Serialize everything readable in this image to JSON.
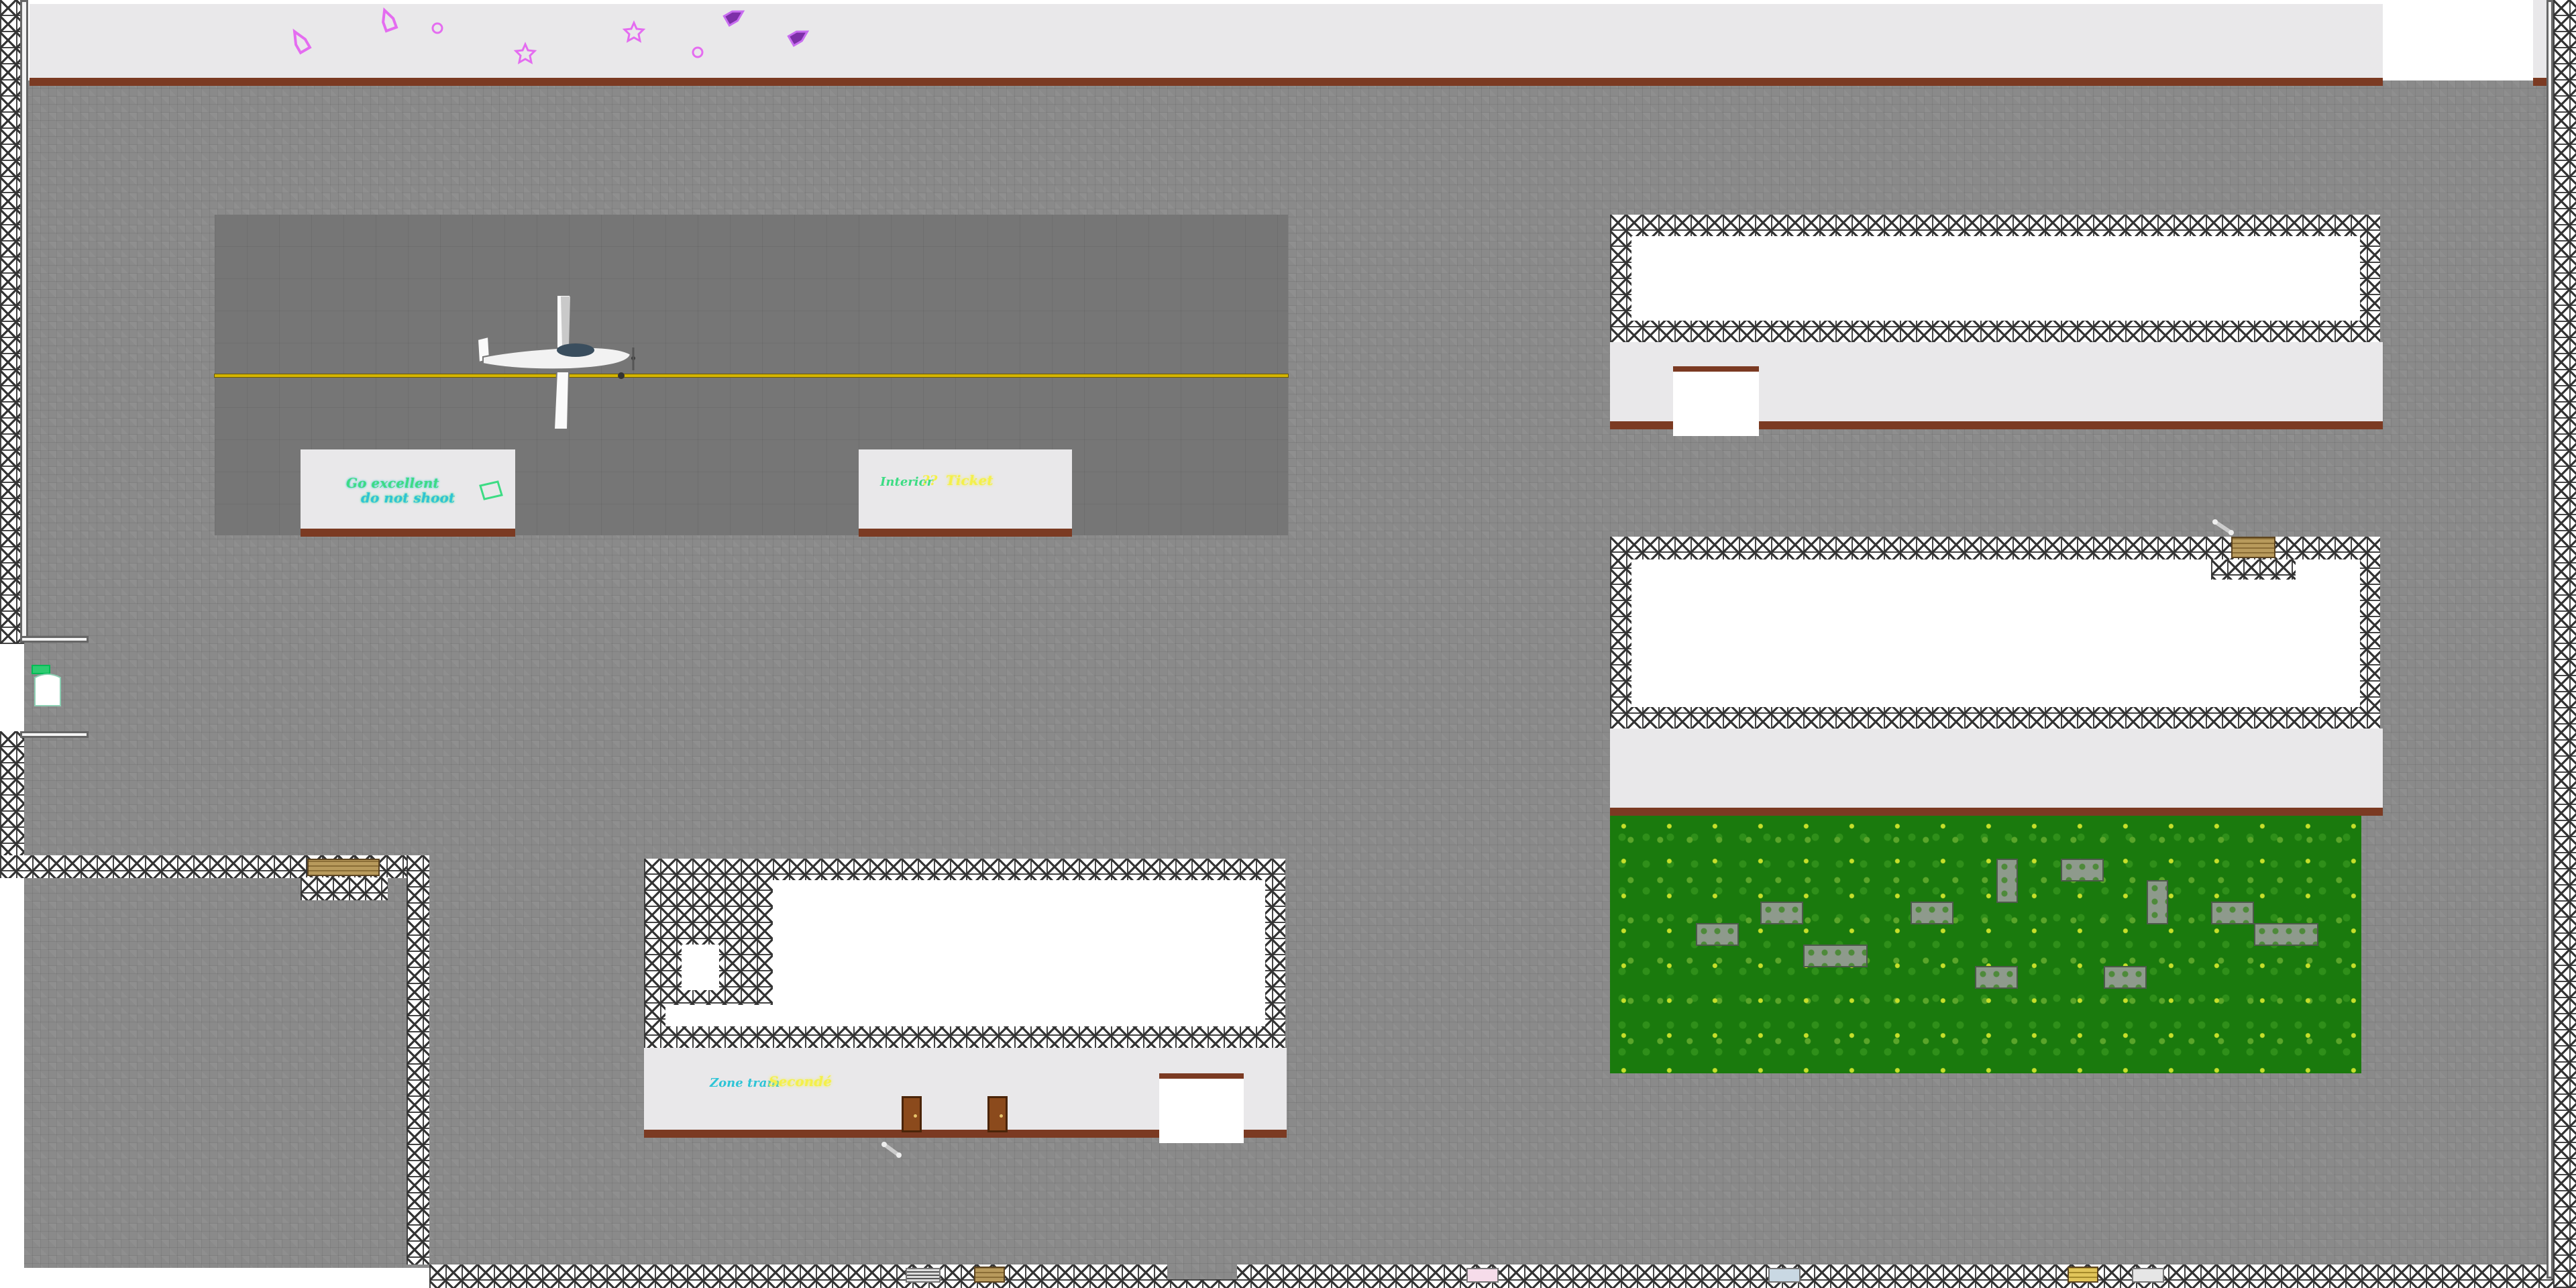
{
  "scene": {
    "title": "",
    "signs": {
      "left_sign_line1": "Go excellent",
      "left_sign_line2": "do not shoot",
      "right_sign_prefix": "Interior",
      "right_sign_mid": "??",
      "right_sign_highlight": "Ticket",
      "bottom_sign_prefix": "Zone tram",
      "bottom_sign_highlight": "Secondé"
    },
    "colors": {
      "plaza": "#8a8a8a",
      "runway": "#767676",
      "centerline": "#d4b500",
      "shelf_trim": "#7b3a22",
      "grass": "#1a7a0d",
      "neon_green": "#3ddc84",
      "neon_cyan": "#2ec4d6",
      "neon_yellow": "#f4f04a",
      "neon_pink": "#e46cf0",
      "neon_purple": "#9b36c8"
    },
    "icons": [
      "airplane-icon",
      "rocket-icon",
      "star-icon",
      "bag-icon",
      "bone-icon",
      "door-icon",
      "crate-icon",
      "exit-sign-icon"
    ]
  }
}
